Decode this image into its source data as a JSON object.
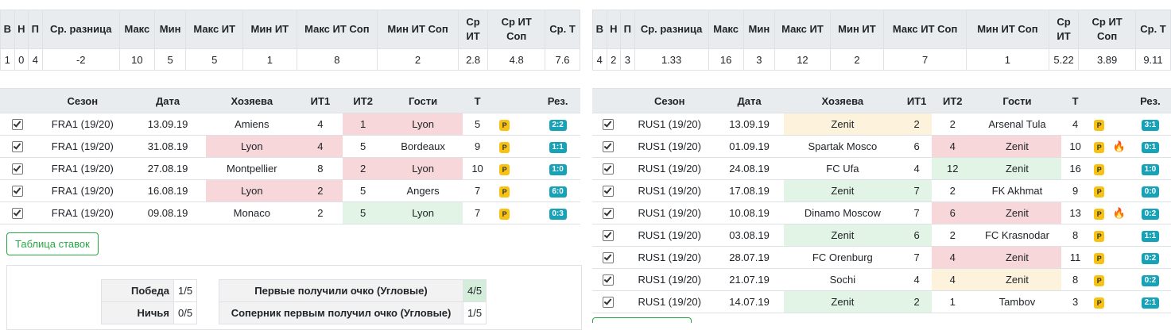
{
  "stats_headers": [
    "В",
    "Н",
    "П",
    "Ср. разница",
    "Макс",
    "Мин",
    "Макс ИТ",
    "Мин ИТ",
    "Макс ИТ Соп",
    "Мин ИТ Соп",
    "Ср ИТ",
    "Ср ИТ Соп",
    "Ср. Т"
  ],
  "match_headers": [
    "",
    "Сезон",
    "Дата",
    "Хозяева",
    "ИТ1",
    "ИТ2",
    "Гости",
    "Т",
    "",
    "",
    "Рез."
  ],
  "left": {
    "stats": [
      "1",
      "0",
      "4",
      "-2",
      "10",
      "5",
      "5",
      "1",
      "8",
      "2",
      "2.8",
      "4.8",
      "7.6"
    ],
    "matches": [
      {
        "season": "FRA1 (19/20)",
        "date": "13.09.19",
        "home": "Amiens",
        "it1": "4",
        "it2": "1",
        "away": "Lyon",
        "t": "5",
        "p": "P",
        "fire": "",
        "res": "2:2",
        "hl": "away-red"
      },
      {
        "season": "FRA1 (19/20)",
        "date": "31.08.19",
        "home": "Lyon",
        "it1": "4",
        "it2": "5",
        "away": "Bordeaux",
        "t": "9",
        "p": "P",
        "fire": "",
        "res": "1:1",
        "hl": "home-red"
      },
      {
        "season": "FRA1 (19/20)",
        "date": "27.08.19",
        "home": "Montpellier",
        "it1": "8",
        "it2": "2",
        "away": "Lyon",
        "t": "10",
        "p": "P",
        "fire": "",
        "res": "1:0",
        "hl": "away-red"
      },
      {
        "season": "FRA1 (19/20)",
        "date": "16.08.19",
        "home": "Lyon",
        "it1": "2",
        "it2": "5",
        "away": "Angers",
        "t": "7",
        "p": "P",
        "fire": "",
        "res": "6:0",
        "hl": "home-red"
      },
      {
        "season": "FRA1 (19/20)",
        "date": "09.08.19",
        "home": "Monaco",
        "it1": "2",
        "it2": "5",
        "away": "Lyon",
        "t": "7",
        "p": "P",
        "fire": "",
        "res": "0:3",
        "hl": "away-green"
      }
    ],
    "button_label": "Таблица ставок",
    "summary": {
      "win_label": "Победа",
      "win_value": "1/5",
      "draw_label": "Ничья",
      "draw_value": "0/5",
      "first_point_label": "Первые получили очко (Угловые)",
      "first_point_value": "4/5",
      "opp_first_label": "Соперник первым получил очко (Угловые)",
      "opp_first_value": "1/5"
    }
  },
  "right": {
    "stats": [
      "4",
      "2",
      "3",
      "1.33",
      "16",
      "3",
      "12",
      "2",
      "7",
      "1",
      "5.22",
      "3.89",
      "9.11"
    ],
    "matches": [
      {
        "season": "RUS1 (19/20)",
        "date": "13.09.19",
        "home": "Zenit",
        "it1": "2",
        "it2": "2",
        "away": "Arsenal Tula",
        "t": "4",
        "p": "P",
        "fire": "",
        "res": "3:1",
        "hl": "home-yellow"
      },
      {
        "season": "RUS1 (19/20)",
        "date": "01.09.19",
        "home": "Spartak Mosco",
        "it1": "6",
        "it2": "4",
        "away": "Zenit",
        "t": "10",
        "p": "P",
        "fire": "🔥",
        "res": "0:1",
        "hl": "away-red"
      },
      {
        "season": "RUS1 (19/20)",
        "date": "24.08.19",
        "home": "FC Ufa",
        "it1": "4",
        "it2": "12",
        "away": "Zenit",
        "t": "16",
        "p": "P",
        "fire": "",
        "res": "1:0",
        "hl": "away-green"
      },
      {
        "season": "RUS1 (19/20)",
        "date": "17.08.19",
        "home": "Zenit",
        "it1": "7",
        "it2": "2",
        "away": "FK Akhmat",
        "t": "9",
        "p": "P",
        "fire": "",
        "res": "0:0",
        "hl": "home-green"
      },
      {
        "season": "RUS1 (19/20)",
        "date": "10.08.19",
        "home": "Dinamo Moscow",
        "it1": "7",
        "it2": "6",
        "away": "Zenit",
        "t": "13",
        "p": "P",
        "fire": "🔥",
        "res": "0:2",
        "hl": "away-red"
      },
      {
        "season": "RUS1 (19/20)",
        "date": "03.08.19",
        "home": "Zenit",
        "it1": "6",
        "it2": "2",
        "away": "FC Krasnodar",
        "t": "8",
        "p": "P",
        "fire": "",
        "res": "1:1",
        "hl": "home-green"
      },
      {
        "season": "RUS1 (19/20)",
        "date": "28.07.19",
        "home": "FC Orenburg",
        "it1": "7",
        "it2": "4",
        "away": "Zenit",
        "t": "11",
        "p": "P",
        "fire": "",
        "res": "0:2",
        "hl": "away-red"
      },
      {
        "season": "RUS1 (19/20)",
        "date": "21.07.19",
        "home": "Sochi",
        "it1": "4",
        "it2": "4",
        "away": "Zenit",
        "t": "8",
        "p": "P",
        "fire": "",
        "res": "0:2",
        "hl": "away-yellow"
      },
      {
        "season": "RUS1 (19/20)",
        "date": "14.07.19",
        "home": "Zenit",
        "it1": "2",
        "it2": "1",
        "away": "Tambov",
        "t": "3",
        "p": "P",
        "fire": "",
        "res": "2:1",
        "hl": "home-green"
      }
    ]
  },
  "colors": {
    "loss": "#f8d7da",
    "win": "#e2f4e5",
    "draw": "#fdf3dc",
    "result_badge": "#17a2b8",
    "p_badge": "#f7c212",
    "button_border": "#28a745"
  },
  "icons": {
    "checkbox": "checked-checkbox-icon",
    "fire": "fire-icon"
  }
}
